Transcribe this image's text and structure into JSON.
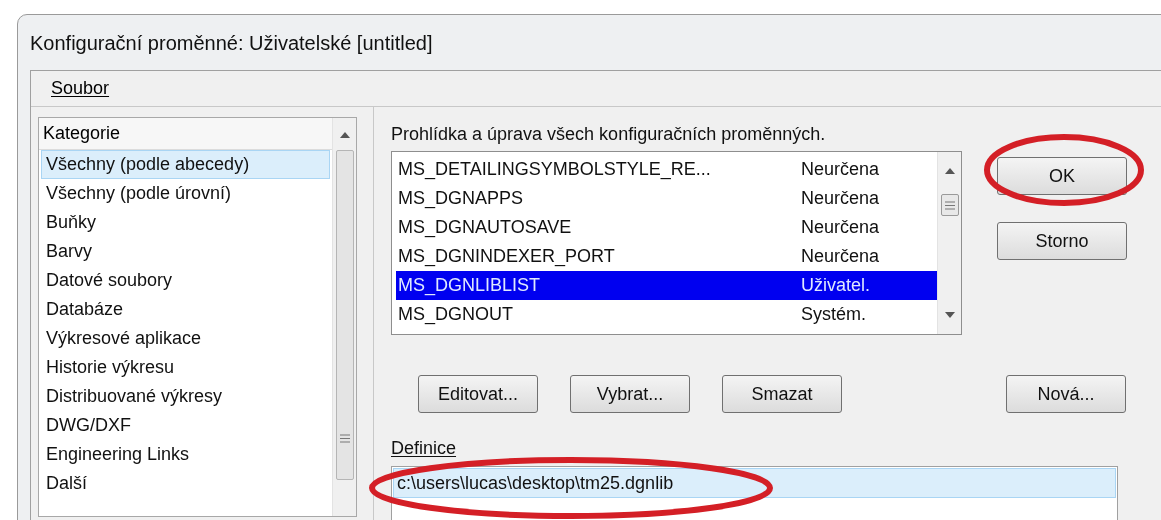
{
  "window": {
    "title": "Konfigurační proměnné: Uživatelské [untitled]"
  },
  "menu": [
    "Soubor"
  ],
  "categories": {
    "header": "Kategorie",
    "items": [
      {
        "label": "Všechny (podle abecedy)",
        "selected": true
      },
      {
        "label": "Všechny (podle úrovní)",
        "selected": false
      },
      {
        "label": "Buňky",
        "selected": false
      },
      {
        "label": "Barvy",
        "selected": false
      },
      {
        "label": "Datové soubory",
        "selected": false
      },
      {
        "label": "Databáze",
        "selected": false
      },
      {
        "label": "Výkresové aplikace",
        "selected": false
      },
      {
        "label": "Historie výkresu",
        "selected": false
      },
      {
        "label": "Distribuované výkresy",
        "selected": false
      },
      {
        "label": "DWG/DXF",
        "selected": false
      },
      {
        "label": "Engineering Links",
        "selected": false
      },
      {
        "label": "Další",
        "selected": false
      }
    ]
  },
  "description": "Prohlídka a úprava všech konfiguračních proměnných.",
  "variables": [
    {
      "name": "MS_DETAILINGSYMBOLSTYLE_RE...",
      "level": "Neurčena",
      "selected": false
    },
    {
      "name": "MS_DGNAPPS",
      "level": "Neurčena",
      "selected": false
    },
    {
      "name": "MS_DGNAUTOSAVE",
      "level": "Neurčena",
      "selected": false
    },
    {
      "name": "MS_DGNINDEXER_PORT",
      "level": "Neurčena",
      "selected": false
    },
    {
      "name": "MS_DGNLIBLIST",
      "level": "Uživatel.",
      "selected": true
    },
    {
      "name": "MS_DGNOUT",
      "level": "Systém.",
      "selected": false
    }
  ],
  "dialog_buttons": [
    "OK",
    "Storno"
  ],
  "action_buttons": [
    "Editovat...",
    "Vybrat...",
    "Smazat",
    "Nová..."
  ],
  "definition": {
    "label": "Definice",
    "value": "c:\\users\\lucas\\desktop\\tm25.dgnlib"
  }
}
